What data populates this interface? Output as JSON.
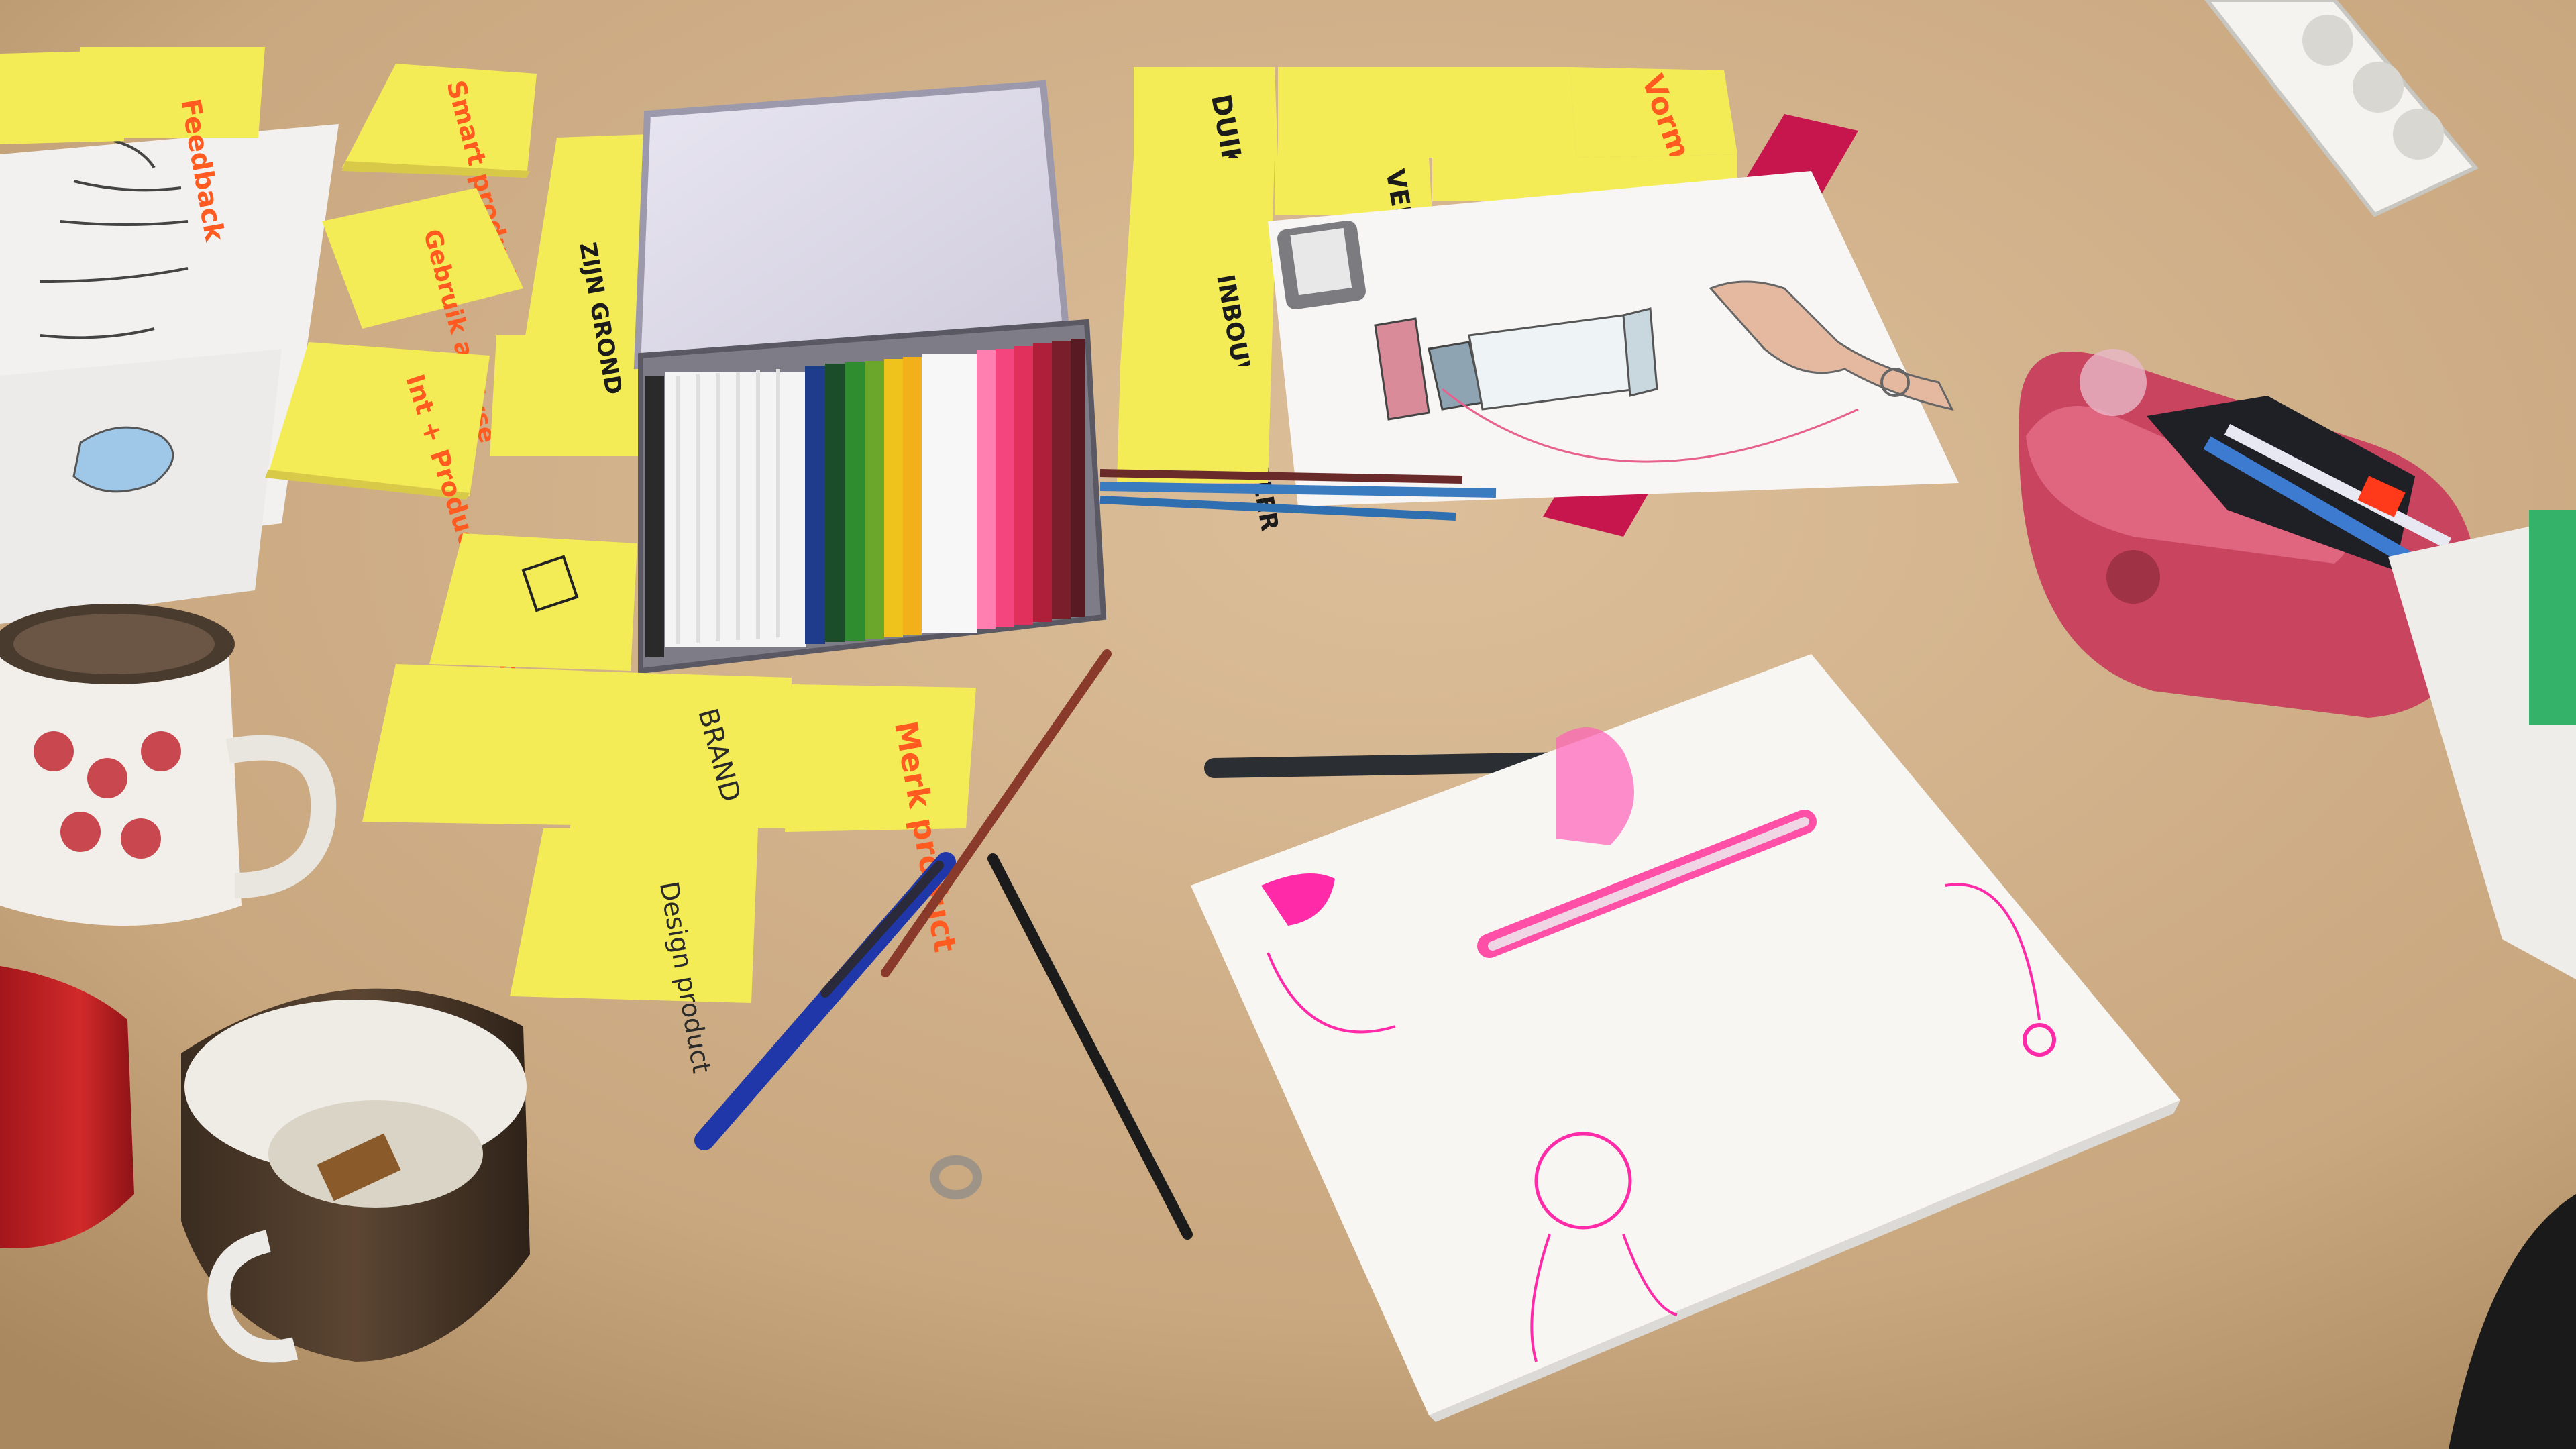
{
  "colors": {
    "table": "#d2b089",
    "table_light": "#dcbf9a",
    "sticky": "#f4ec56",
    "sticky_shadow": "#c9b94a",
    "marker_red": "#ff5a1f",
    "marker_black": "#1b1b1b",
    "paper": "#f6f5f3",
    "pink_ink": "#ff2aa8"
  },
  "notes": {
    "feedback": "Feedback",
    "smart_product": "Smart product",
    "gebruik_analyse": "Gebruik analyse",
    "int_product_presentatie": "Int + Product presentatie",
    "duik_sell": "DUIK SELL",
    "vorm": "Vorm",
    "vereis": "VEREIS",
    "inbouw_inhaler": "INBOUW - INHALER",
    "merk_product": "Merk product",
    "brand": "BRAND",
    "design_product": "Design product",
    "zijn_grond": "ZIJN GROND",
    "nog": "NOG"
  },
  "icons": [
    "pencil-tin-icon",
    "pencil-case-icon",
    "mug-icon",
    "pen-icon",
    "pencil-icon",
    "ring-icon",
    "power-strip-icon",
    "inhaler-sketch-icon",
    "hand-sketch-icon",
    "face-sketch-icon"
  ]
}
